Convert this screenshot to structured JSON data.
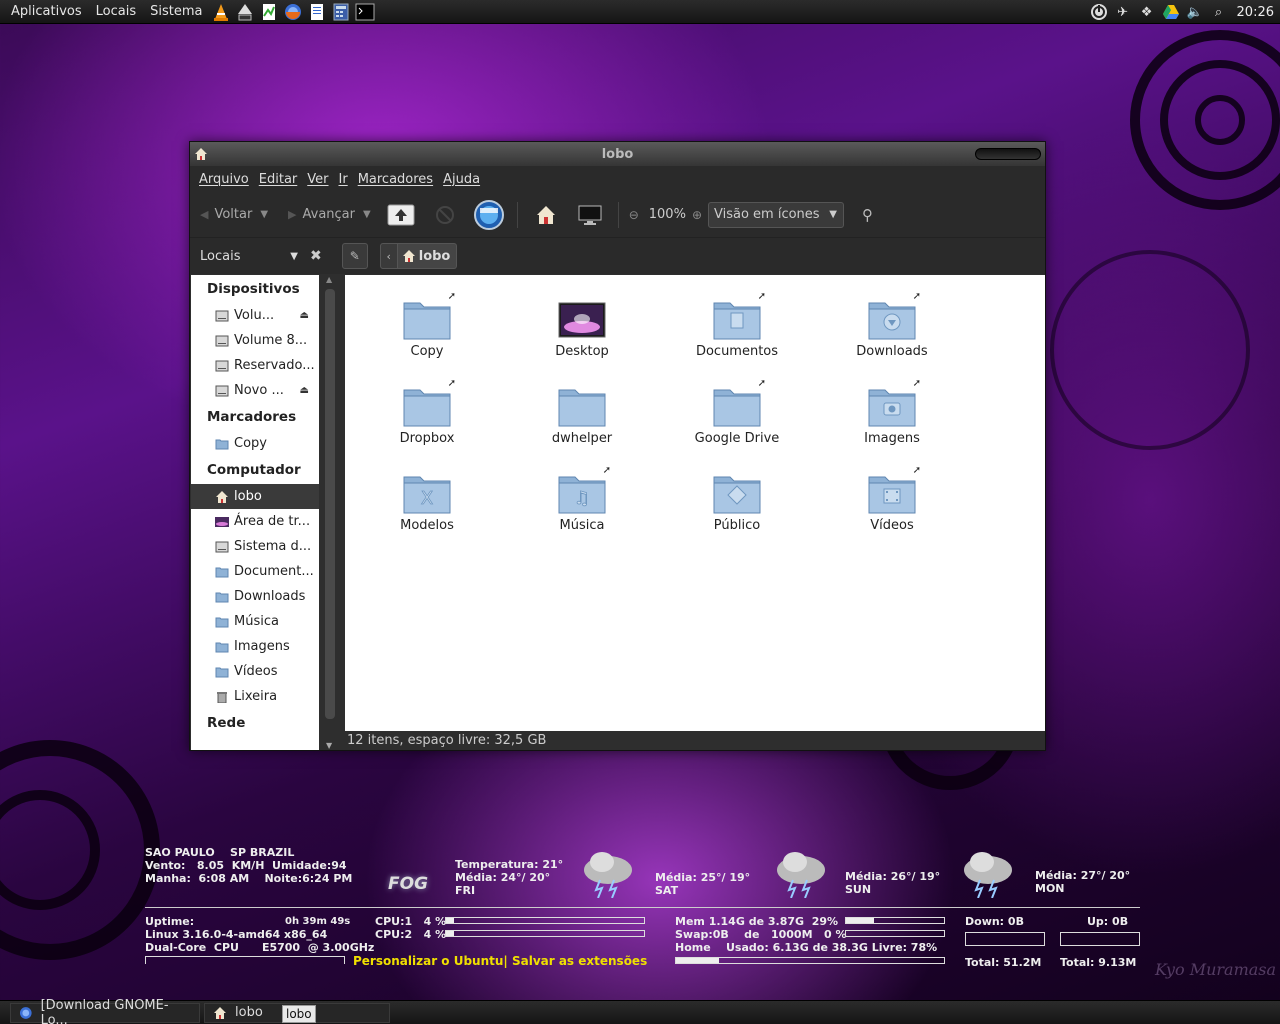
{
  "top_panel": {
    "menus": [
      "Aplicativos",
      "Locais",
      "Sistema"
    ],
    "launchers": [
      "vlc-icon",
      "inkscape-icon",
      "libreoffice-calc-icon",
      "firefox-icon",
      "writer-icon",
      "calculator-icon",
      "terminal-icon"
    ],
    "tray_icons": [
      "power-icon",
      "bird-icon",
      "dropbox-icon",
      "google-drive-icon",
      "volume-icon",
      "network-icon"
    ],
    "clock": "20:26"
  },
  "window": {
    "title": "lobo",
    "menu": [
      "Arquivo",
      "Editar",
      "Ver",
      "Ir",
      "Marcadores",
      "Ajuda"
    ],
    "toolbar": {
      "back": "Voltar",
      "forward": "Avançar",
      "zoom": "100%",
      "view_mode": "Visão em ícones"
    },
    "location": {
      "places_label": "Locais",
      "crumb": "lobo"
    },
    "sidebar": {
      "sections": [
        {
          "title": "Dispositivos",
          "items": [
            {
              "label": "Volu...",
              "icon": "drive-icon",
              "eject": true
            },
            {
              "label": "Volume 8...",
              "icon": "drive-icon",
              "eject": false
            },
            {
              "label": "Reservado...",
              "icon": "drive-icon",
              "eject": false
            },
            {
              "label": "Novo ...",
              "icon": "drive-icon",
              "eject": true
            }
          ]
        },
        {
          "title": "Marcadores",
          "items": [
            {
              "label": "Copy",
              "icon": "folder-icon"
            }
          ]
        },
        {
          "title": "Computador",
          "items": [
            {
              "label": "lobo",
              "icon": "home-icon",
              "active": true
            },
            {
              "label": "Área de tr...",
              "icon": "desktop-icon"
            },
            {
              "label": "Sistema d...",
              "icon": "drive-icon"
            },
            {
              "label": "Document...",
              "icon": "folder-icon"
            },
            {
              "label": "Downloads",
              "icon": "folder-icon"
            },
            {
              "label": "Música",
              "icon": "folder-icon"
            },
            {
              "label": "Imagens",
              "icon": "folder-icon"
            },
            {
              "label": "Vídeos",
              "icon": "folder-icon"
            },
            {
              "label": "Lixeira",
              "icon": "trash-icon"
            }
          ]
        },
        {
          "title": "Rede",
          "items": []
        }
      ]
    },
    "files": [
      {
        "label": "Copy",
        "icon": "folder-icon",
        "link": true
      },
      {
        "label": "Desktop",
        "icon": "desktop-folder-icon",
        "link": false
      },
      {
        "label": "Documentos",
        "icon": "documents-folder-icon",
        "link": true
      },
      {
        "label": "Downloads",
        "icon": "downloads-folder-icon",
        "link": true
      },
      {
        "label": "Dropbox",
        "icon": "folder-icon",
        "link": true
      },
      {
        "label": "dwhelper",
        "icon": "folder-icon",
        "link": false
      },
      {
        "label": "Google Drive",
        "icon": "folder-icon",
        "link": true
      },
      {
        "label": "Imagens",
        "icon": "pictures-folder-icon",
        "link": true
      },
      {
        "label": "Modelos",
        "icon": "templates-folder-icon",
        "link": false
      },
      {
        "label": "Música",
        "icon": "music-folder-icon",
        "link": true
      },
      {
        "label": "Público",
        "icon": "public-folder-icon",
        "link": false
      },
      {
        "label": "Vídeos",
        "icon": "videos-folder-icon",
        "link": true
      }
    ],
    "status": "12 itens, espaço livre: 32,5 GB"
  },
  "conky": {
    "weather": {
      "line1": "SAO PAULO    SP BRAZIL",
      "line2": "Vento:   8.05  KM/H  Umidade:94",
      "line3": "Manha:  6:08 AM    Noite:6:24 PM",
      "fog_label": "FOG",
      "today": "Temperatura: 21°\nMédia: 24°/ 20°\nFRI",
      "day1": "Média: 25°/ 19°\nSAT",
      "day2": "Média: 26°/ 19°\nSUN",
      "day3": "Média: 27°/ 20°\nMON"
    },
    "sys": {
      "uptime_label": "Uptime:",
      "uptime": "0h 39m 49s",
      "kernel": "Linux 3.16.0-4-amd64 x86_64",
      "cpu_model": "Dual-Core  CPU      E5700  @ 3.00GHz",
      "cpu1": "CPU:1   4 %",
      "cpu2": "CPU:2   4 %",
      "cpu1_level": 0.04,
      "cpu2_level": 0.04
    },
    "mem": {
      "mem_line": "Mem 1.14G de 3.87G  29%",
      "swap_line": "Swap:0B    de   1000M   0 %",
      "home_line": "Home    Usado: 6.13G de 38.3G Livre: 78%",
      "mem_level": 0.29,
      "swap_level": 0.0,
      "home_level": 0.16
    },
    "net": {
      "down": "Down: 0B",
      "up": "Up: 0B",
      "total_down": "Total: 51.2M",
      "total_up": "Total: 9.13M"
    },
    "link_text": "Personalizar o Ubuntu| Salvar as extensões"
  },
  "signature": "Kyo Muramasa",
  "bottom_panel": {
    "tasks": [
      {
        "label": "[Download GNOME-Lo...",
        "icon": "firefox-icon"
      },
      {
        "label": "lobo",
        "icon": "home-icon"
      }
    ],
    "tooltip": "lobo"
  }
}
